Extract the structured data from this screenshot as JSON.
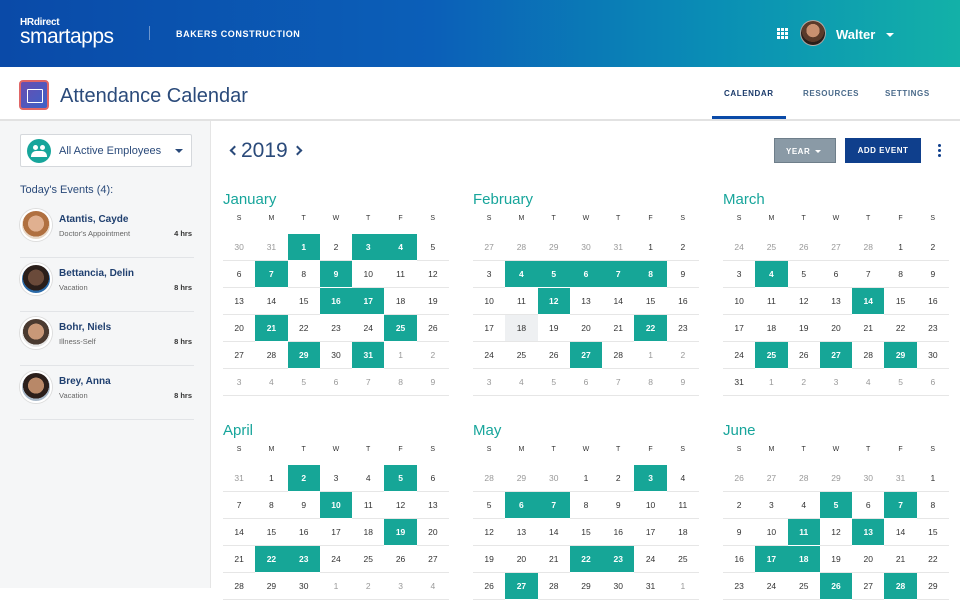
{
  "header": {
    "logo_top": "HRdirect",
    "logo_main": "smartapps",
    "company": "BAKERS CONSTRUCTION",
    "user_name": "Walter"
  },
  "subheader": {
    "title": "Attendance Calendar",
    "tabs": [
      "CALENDAR",
      "RESOURCES",
      "SETTINGS"
    ],
    "active_tab": "CALENDAR"
  },
  "sidebar": {
    "filter_label": "All Active Employees",
    "events_title": "Today's Events (4):",
    "events": [
      {
        "name": "Atantis, Cayde",
        "desc": "Doctor's Appointment",
        "hours": "4 hrs"
      },
      {
        "name": "Bettancia, Delin",
        "desc": "Vacation",
        "hours": "8 hrs"
      },
      {
        "name": "Bohr, Niels",
        "desc": "Illness-Self",
        "hours": "8 hrs"
      },
      {
        "name": "Brey, Anna",
        "desc": "Vacation",
        "hours": "8 hrs"
      }
    ]
  },
  "toolbar": {
    "year": "2019",
    "view_label": "YEAR",
    "add_label": "ADD EVENT"
  },
  "dow": [
    "S",
    "M",
    "T",
    "W",
    "T",
    "F",
    "S"
  ],
  "colors": {
    "accent": "#16a697",
    "primary": "#0f3f8c"
  },
  "months": [
    {
      "name": "January",
      "days": [
        [
          "30",
          "o"
        ],
        [
          "31",
          "o"
        ],
        [
          "1",
          "h"
        ],
        [
          "2",
          ""
        ],
        [
          "3",
          "h"
        ],
        [
          "4",
          "h"
        ],
        [
          "5",
          ""
        ],
        [
          "6",
          ""
        ],
        [
          "7",
          "h"
        ],
        [
          "8",
          ""
        ],
        [
          "9",
          "h"
        ],
        [
          "10",
          ""
        ],
        [
          "11",
          ""
        ],
        [
          "12",
          ""
        ],
        [
          "13",
          ""
        ],
        [
          "14",
          ""
        ],
        [
          "15",
          ""
        ],
        [
          "16",
          "h"
        ],
        [
          "17",
          "h"
        ],
        [
          "18",
          ""
        ],
        [
          "19",
          ""
        ],
        [
          "20",
          ""
        ],
        [
          "21",
          "h"
        ],
        [
          "22",
          ""
        ],
        [
          "23",
          ""
        ],
        [
          "24",
          ""
        ],
        [
          "25",
          "h"
        ],
        [
          "26",
          ""
        ],
        [
          "27",
          ""
        ],
        [
          "28",
          ""
        ],
        [
          "29",
          "h"
        ],
        [
          "30",
          ""
        ],
        [
          "31",
          "h"
        ],
        [
          "1",
          "o"
        ],
        [
          "2",
          "o"
        ],
        [
          "3",
          "o"
        ],
        [
          "4",
          "o"
        ],
        [
          "5",
          "o"
        ],
        [
          "6",
          "o"
        ],
        [
          "7",
          "o"
        ],
        [
          "8",
          "o"
        ],
        [
          "9",
          "o"
        ]
      ]
    },
    {
      "name": "February",
      "days": [
        [
          "27",
          "o"
        ],
        [
          "28",
          "o"
        ],
        [
          "29",
          "o"
        ],
        [
          "30",
          "o"
        ],
        [
          "31",
          "o"
        ],
        [
          "1",
          ""
        ],
        [
          "2",
          ""
        ],
        [
          "3",
          ""
        ],
        [
          "4",
          "h"
        ],
        [
          "5",
          "h"
        ],
        [
          "6",
          "h"
        ],
        [
          "7",
          "h"
        ],
        [
          "8",
          "h"
        ],
        [
          "9",
          ""
        ],
        [
          "10",
          ""
        ],
        [
          "11",
          ""
        ],
        [
          "12",
          "h"
        ],
        [
          "13",
          ""
        ],
        [
          "14",
          ""
        ],
        [
          "15",
          ""
        ],
        [
          "16",
          ""
        ],
        [
          "17",
          ""
        ],
        [
          "18",
          "t"
        ],
        [
          "19",
          ""
        ],
        [
          "20",
          ""
        ],
        [
          "21",
          ""
        ],
        [
          "22",
          "h"
        ],
        [
          "23",
          ""
        ],
        [
          "24",
          ""
        ],
        [
          "25",
          ""
        ],
        [
          "26",
          ""
        ],
        [
          "27",
          "h"
        ],
        [
          "28",
          ""
        ],
        [
          "1",
          "o"
        ],
        [
          "2",
          "o"
        ],
        [
          "3",
          "o"
        ],
        [
          "4",
          "o"
        ],
        [
          "5",
          "o"
        ],
        [
          "6",
          "o"
        ],
        [
          "7",
          "o"
        ],
        [
          "8",
          "o"
        ],
        [
          "9",
          "o"
        ]
      ]
    },
    {
      "name": "March",
      "days": [
        [
          "24",
          "o"
        ],
        [
          "25",
          "o"
        ],
        [
          "26",
          "o"
        ],
        [
          "27",
          "o"
        ],
        [
          "28",
          "o"
        ],
        [
          "1",
          ""
        ],
        [
          "2",
          ""
        ],
        [
          "3",
          ""
        ],
        [
          "4",
          "h"
        ],
        [
          "5",
          ""
        ],
        [
          "6",
          ""
        ],
        [
          "7",
          ""
        ],
        [
          "8",
          ""
        ],
        [
          "9",
          ""
        ],
        [
          "10",
          ""
        ],
        [
          "11",
          ""
        ],
        [
          "12",
          ""
        ],
        [
          "13",
          ""
        ],
        [
          "14",
          "h"
        ],
        [
          "15",
          ""
        ],
        [
          "16",
          ""
        ],
        [
          "17",
          ""
        ],
        [
          "18",
          ""
        ],
        [
          "19",
          ""
        ],
        [
          "20",
          ""
        ],
        [
          "21",
          ""
        ],
        [
          "22",
          ""
        ],
        [
          "23",
          ""
        ],
        [
          "24",
          ""
        ],
        [
          "25",
          "h"
        ],
        [
          "26",
          ""
        ],
        [
          "27",
          "h"
        ],
        [
          "28",
          ""
        ],
        [
          "29",
          "h"
        ],
        [
          "30",
          ""
        ],
        [
          "31",
          ""
        ],
        [
          "1",
          "o"
        ],
        [
          "2",
          "o"
        ],
        [
          "3",
          "o"
        ],
        [
          "4",
          "o"
        ],
        [
          "5",
          "o"
        ],
        [
          "6",
          "o"
        ]
      ]
    },
    {
      "name": "April",
      "days": [
        [
          "31",
          "o"
        ],
        [
          "1",
          ""
        ],
        [
          "2",
          "h"
        ],
        [
          "3",
          ""
        ],
        [
          "4",
          ""
        ],
        [
          "5",
          "h"
        ],
        [
          "6",
          ""
        ],
        [
          "7",
          ""
        ],
        [
          "8",
          ""
        ],
        [
          "9",
          ""
        ],
        [
          "10",
          "h"
        ],
        [
          "11",
          ""
        ],
        [
          "12",
          ""
        ],
        [
          "13",
          ""
        ],
        [
          "14",
          ""
        ],
        [
          "15",
          ""
        ],
        [
          "16",
          ""
        ],
        [
          "17",
          ""
        ],
        [
          "18",
          ""
        ],
        [
          "19",
          "h"
        ],
        [
          "20",
          ""
        ],
        [
          "21",
          ""
        ],
        [
          "22",
          "h"
        ],
        [
          "23",
          "h"
        ],
        [
          "24",
          ""
        ],
        [
          "25",
          ""
        ],
        [
          "26",
          ""
        ],
        [
          "27",
          ""
        ],
        [
          "28",
          ""
        ],
        [
          "29",
          ""
        ],
        [
          "30",
          ""
        ],
        [
          "1",
          "o"
        ],
        [
          "2",
          "o"
        ],
        [
          "3",
          "o"
        ],
        [
          "4",
          "o"
        ]
      ]
    },
    {
      "name": "May",
      "days": [
        [
          "28",
          "o"
        ],
        [
          "29",
          "o"
        ],
        [
          "30",
          "o"
        ],
        [
          "1",
          ""
        ],
        [
          "2",
          ""
        ],
        [
          "3",
          "h"
        ],
        [
          "4",
          ""
        ],
        [
          "5",
          ""
        ],
        [
          "6",
          "h"
        ],
        [
          "7",
          "h"
        ],
        [
          "8",
          ""
        ],
        [
          "9",
          ""
        ],
        [
          "10",
          ""
        ],
        [
          "11",
          ""
        ],
        [
          "12",
          ""
        ],
        [
          "13",
          ""
        ],
        [
          "14",
          ""
        ],
        [
          "15",
          ""
        ],
        [
          "16",
          ""
        ],
        [
          "17",
          ""
        ],
        [
          "18",
          ""
        ],
        [
          "19",
          ""
        ],
        [
          "20",
          ""
        ],
        [
          "21",
          ""
        ],
        [
          "22",
          "h"
        ],
        [
          "23",
          "h"
        ],
        [
          "24",
          ""
        ],
        [
          "25",
          ""
        ],
        [
          "26",
          ""
        ],
        [
          "27",
          "h"
        ],
        [
          "28",
          ""
        ],
        [
          "29",
          ""
        ],
        [
          "30",
          ""
        ],
        [
          "31",
          ""
        ],
        [
          "1",
          "o"
        ]
      ]
    },
    {
      "name": "June",
      "days": [
        [
          "26",
          "o"
        ],
        [
          "27",
          "o"
        ],
        [
          "28",
          "o"
        ],
        [
          "29",
          "o"
        ],
        [
          "30",
          "o"
        ],
        [
          "31",
          "o"
        ],
        [
          "1",
          ""
        ],
        [
          "2",
          ""
        ],
        [
          "3",
          ""
        ],
        [
          "4",
          ""
        ],
        [
          "5",
          "h"
        ],
        [
          "6",
          ""
        ],
        [
          "7",
          "h"
        ],
        [
          "8",
          ""
        ],
        [
          "9",
          ""
        ],
        [
          "10",
          ""
        ],
        [
          "11",
          "h"
        ],
        [
          "12",
          ""
        ],
        [
          "13",
          "h"
        ],
        [
          "14",
          ""
        ],
        [
          "15",
          ""
        ],
        [
          "16",
          ""
        ],
        [
          "17",
          "h"
        ],
        [
          "18",
          "h"
        ],
        [
          "19",
          ""
        ],
        [
          "20",
          ""
        ],
        [
          "21",
          ""
        ],
        [
          "22",
          ""
        ],
        [
          "23",
          ""
        ],
        [
          "24",
          ""
        ],
        [
          "25",
          ""
        ],
        [
          "26",
          "h"
        ],
        [
          "27",
          ""
        ],
        [
          "28",
          "h"
        ],
        [
          "29",
          ""
        ]
      ]
    }
  ]
}
